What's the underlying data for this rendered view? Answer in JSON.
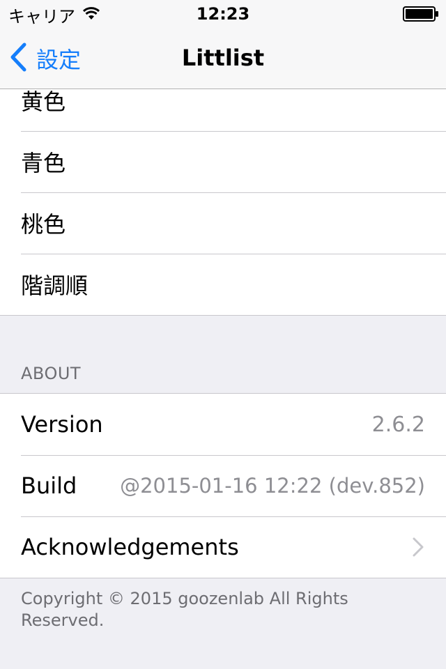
{
  "status_bar": {
    "carrier": "キャリア",
    "time": "12:23",
    "icons": [
      "wifi-icon",
      "battery-icon"
    ]
  },
  "nav": {
    "back_label": "設定",
    "title": "Littlist"
  },
  "color_list": {
    "items": [
      "黄色",
      "青色",
      "桃色",
      "階調順"
    ]
  },
  "about": {
    "header": "ABOUT",
    "rows": [
      {
        "label": "Version",
        "value": "2.6.2"
      },
      {
        "label": "Build",
        "value": "@2015-01-16 12:22 (dev.852)"
      },
      {
        "label": "Acknowledgements",
        "value": ""
      }
    ],
    "footer": "Copyright © 2015 goozenlab All Rights Reserved."
  },
  "colors": {
    "accent": "#157efb",
    "separator": "#c8c7cc",
    "grouped_background": "#efeff4",
    "secondary_text": "#8e8e93"
  }
}
